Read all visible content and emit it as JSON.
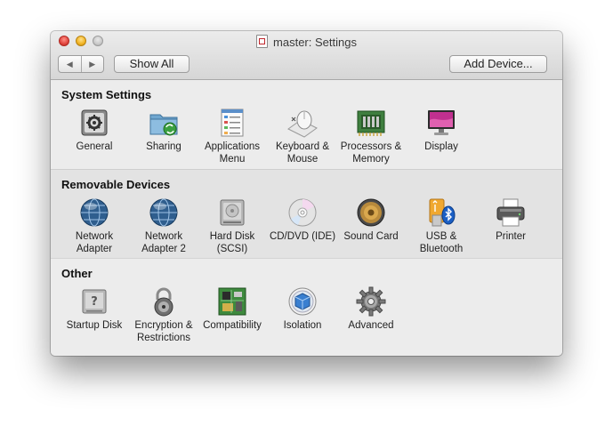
{
  "window": {
    "title": "master: Settings",
    "show_all_label": "Show All",
    "add_device_label": "Add Device...",
    "back_arrow": "◀",
    "forward_arrow": "▶"
  },
  "sections": {
    "system": {
      "title": "System Settings",
      "items": {
        "general": {
          "label": "General",
          "icon": "general-icon"
        },
        "sharing": {
          "label": "Sharing",
          "icon": "sharing-icon"
        },
        "apps_menu": {
          "label": "Applications Menu",
          "icon": "applications-menu-icon"
        },
        "keyboard": {
          "label": "Keyboard & Mouse",
          "icon": "keyboard-mouse-icon"
        },
        "processors": {
          "label": "Processors & Memory",
          "icon": "processors-memory-icon"
        },
        "display": {
          "label": "Display",
          "icon": "display-icon"
        }
      }
    },
    "removable": {
      "title": "Removable Devices",
      "items": {
        "net1": {
          "label": "Network Adapter",
          "icon": "network-adapter-icon"
        },
        "net2": {
          "label": "Network Adapter 2",
          "icon": "network-adapter-icon"
        },
        "hdd": {
          "label": "Hard Disk (SCSI)",
          "icon": "hard-disk-icon"
        },
        "cdvd": {
          "label": "CD/DVD (IDE)",
          "icon": "cd-dvd-icon"
        },
        "sound": {
          "label": "Sound Card",
          "icon": "sound-card-icon"
        },
        "usb": {
          "label": "USB & Bluetooth",
          "icon": "usb-bluetooth-icon"
        },
        "printer": {
          "label": "Printer",
          "icon": "printer-icon"
        }
      }
    },
    "other": {
      "title": "Other",
      "items": {
        "startup": {
          "label": "Startup Disk",
          "icon": "startup-disk-icon"
        },
        "encryption": {
          "label": "Encryption & Restrictions",
          "icon": "lock-icon"
        },
        "compat": {
          "label": "Compatibility",
          "icon": "compatibility-icon"
        },
        "isolation": {
          "label": "Isolation",
          "icon": "isolation-icon"
        },
        "advanced": {
          "label": "Advanced",
          "icon": "gear-icon"
        }
      }
    }
  }
}
